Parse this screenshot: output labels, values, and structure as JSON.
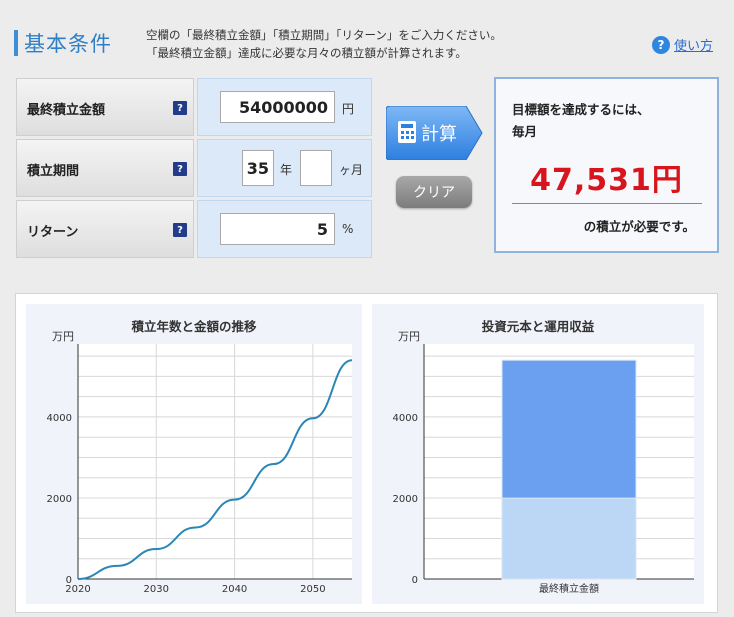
{
  "header": {
    "title": "基本条件",
    "instruction_line1": "空欄の「最終積立金額」「積立期間」「リターン」をご入力ください。",
    "instruction_line2": "「最終積立金額」達成に必要な月々の積立額が計算されます。",
    "help_icon": "?",
    "help_label": "使い方"
  },
  "form": {
    "help_icon": "?",
    "rows": [
      {
        "label": "最終積立金額",
        "value": "54000000",
        "unit": "円"
      },
      {
        "label": "積立期間",
        "years": "35",
        "years_unit": "年",
        "months": "",
        "months_unit": "ヶ月"
      },
      {
        "label": "リターン",
        "value": "5",
        "unit": "%"
      }
    ]
  },
  "buttons": {
    "calc_label": "計算",
    "clear_label": "クリア"
  },
  "result": {
    "line1": "目標額を達成するには、",
    "line2": "毎月",
    "amount": "47,531円",
    "line3": "の積立が必要です。"
  },
  "chart_data": [
    {
      "type": "line",
      "title": "積立年数と金額の推移",
      "ylabel": "万円",
      "xlabel": "",
      "x_ticks": [
        "2020",
        "2030",
        "2040",
        "2050"
      ],
      "y_ticks": [
        "0",
        "2000",
        "4000"
      ],
      "xlim": [
        2020,
        2055
      ],
      "ylim": [
        0,
        5800
      ],
      "grid": true,
      "color": "#2b86b8",
      "x": [
        2020,
        2025,
        2030,
        2035,
        2040,
        2045,
        2050,
        2055
      ],
      "y": [
        0,
        323,
        739,
        1272,
        1958,
        2837,
        3966,
        5400
      ]
    },
    {
      "type": "bar",
      "title": "投資元本と運用収益",
      "ylabel": "万円",
      "xlabel": "",
      "categories": [
        "最終積立金額"
      ],
      "y_ticks": [
        "0",
        "2000",
        "4000"
      ],
      "ylim": [
        0,
        5800
      ],
      "grid": true,
      "stacked": true,
      "series": [
        {
          "values": [
            1996
          ],
          "color": "#bcd7f6"
        },
        {
          "values": [
            3404
          ],
          "color": "#6b9ff0"
        }
      ]
    }
  ]
}
